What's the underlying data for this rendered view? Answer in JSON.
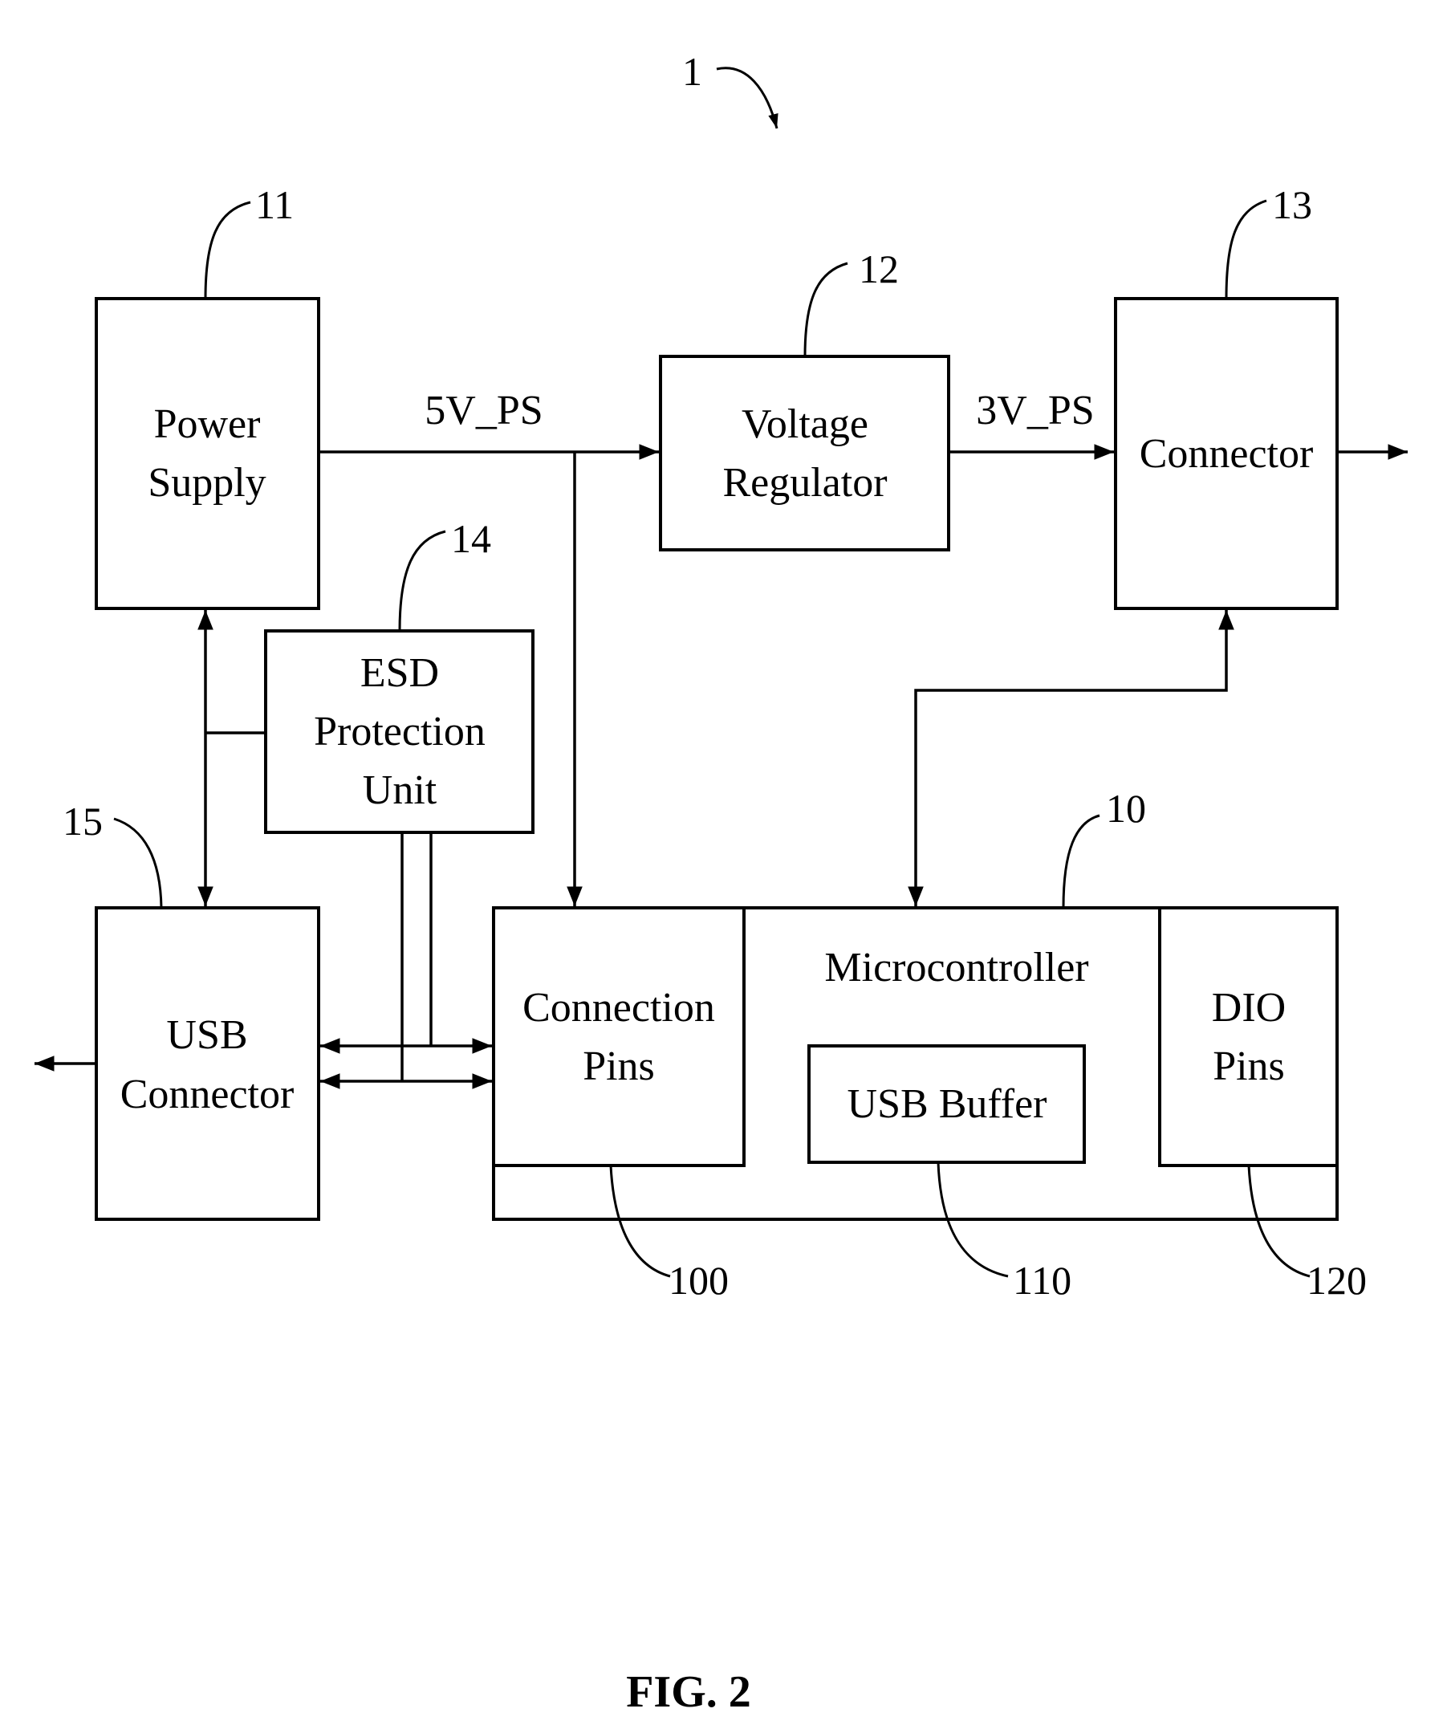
{
  "figure": {
    "caption": "FIG. 2",
    "system_ref": "1"
  },
  "blocks": {
    "power_supply": {
      "lines": [
        "Power",
        "Supply"
      ],
      "ref": "11"
    },
    "voltage_regulator": {
      "lines": [
        "Voltage",
        "Regulator"
      ],
      "ref": "12"
    },
    "connector": {
      "lines": [
        "Connector"
      ],
      "ref": "13"
    },
    "esd_protection": {
      "lines": [
        "ESD",
        "Protection",
        "Unit"
      ],
      "ref": "14"
    },
    "usb_connector": {
      "lines": [
        "USB",
        "Connector"
      ],
      "ref": "15"
    },
    "microcontroller": {
      "label": "Microcontroller",
      "ref": "10",
      "connection_pins": {
        "lines": [
          "Connection",
          "Pins"
        ],
        "ref": "100"
      },
      "usb_buffer": {
        "label": "USB Buffer",
        "ref": "110"
      },
      "dio_pins": {
        "lines": [
          "DIO",
          "Pins"
        ],
        "ref": "120"
      }
    }
  },
  "signals": {
    "five_volt": "5V_PS",
    "three_volt": "3V_PS"
  }
}
